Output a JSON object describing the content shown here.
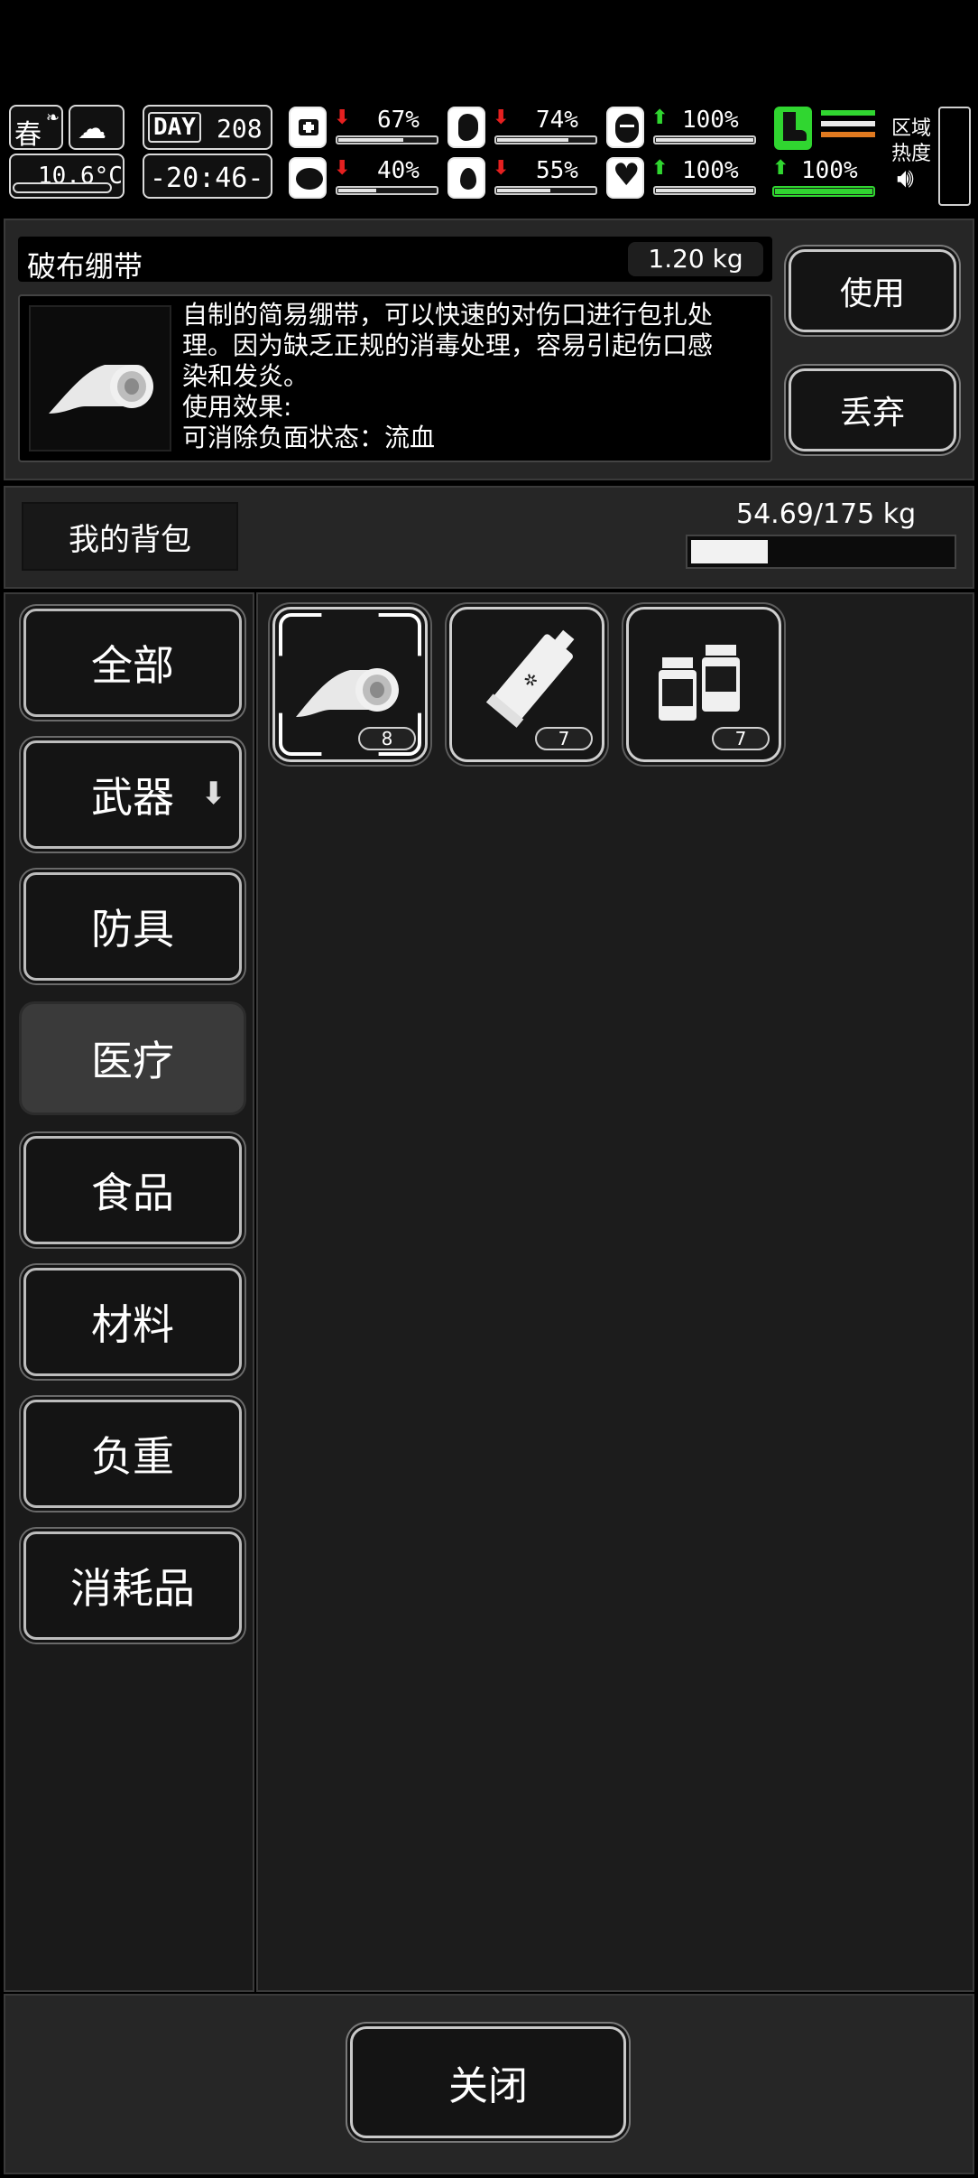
{
  "hud": {
    "season": "春",
    "temperature": "10.6°C",
    "day_label": "DAY",
    "day_number": "208",
    "clock": "-20:46-",
    "stats": [
      {
        "name": "health",
        "value": "67%",
        "trend": "down",
        "level": 0.67
      },
      {
        "name": "hunger",
        "value": "74%",
        "trend": "down",
        "level": 0.74
      },
      {
        "name": "mood",
        "value": "100%",
        "trend": "up",
        "level": 1.0
      },
      {
        "name": "immunity",
        "value": "40%",
        "trend": "down",
        "level": 0.4
      },
      {
        "name": "thirst",
        "value": "55%",
        "trend": "down",
        "level": 0.55
      },
      {
        "name": "heart",
        "value": "100%",
        "trend": "up",
        "level": 1.0
      },
      {
        "name": "stamina",
        "value": "100%",
        "trend": "up",
        "level": 1.0
      }
    ],
    "zone_heat_label_1": "区域",
    "zone_heat_label_2": "热度",
    "colors": {
      "green": "#30d630",
      "red": "#e52020",
      "orange": "#e07a20"
    }
  },
  "detail": {
    "item_name": "破布绷带",
    "item_weight": "1.20 kg",
    "description_line1": "自制的简易绷带，可以快速的对伤口进行包扎处",
    "description_line2": "理。因为缺乏正规的消毒处理，容易引起伤口感",
    "description_line3": "染和发炎。",
    "description_line4": "使用效果:",
    "description_line5": "可消除负面状态：流血",
    "use_label": "使用",
    "discard_label": "丢弃"
  },
  "backpack": {
    "title": "我的背包",
    "capacity": "54.69/175 kg",
    "load_fraction": 0.3125
  },
  "categories": [
    {
      "label": "全部",
      "active": false
    },
    {
      "label": "武器",
      "active": false
    },
    {
      "label": "防具",
      "active": false
    },
    {
      "label": "医疗",
      "active": true
    },
    {
      "label": "食品",
      "active": false
    },
    {
      "label": "材料",
      "active": false
    },
    {
      "label": "负重",
      "active": false
    },
    {
      "label": "消耗品",
      "active": false
    }
  ],
  "items": [
    {
      "icon": "bandage-icon",
      "count": "8",
      "selected": true
    },
    {
      "icon": "ointment-tube-icon",
      "count": "7",
      "selected": false
    },
    {
      "icon": "medicine-bottles-icon",
      "count": "7",
      "selected": false
    }
  ],
  "footer": {
    "close_label": "关闭"
  }
}
